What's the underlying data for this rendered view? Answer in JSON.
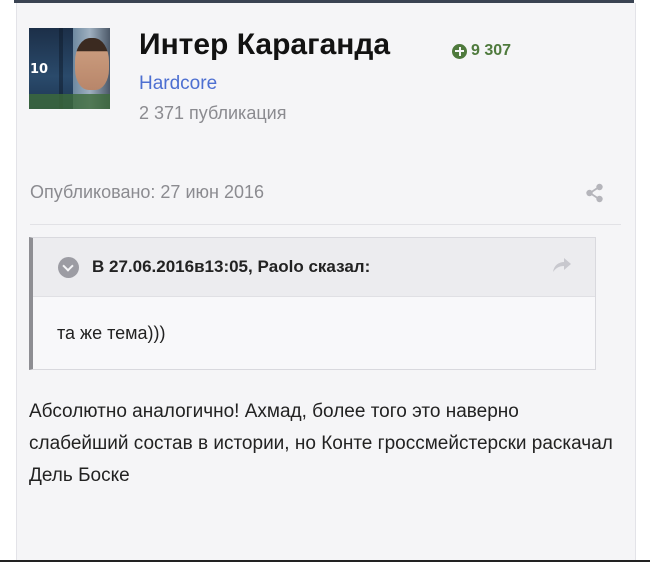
{
  "author": {
    "name": "Интер Караганда",
    "reputation": "9 307",
    "group": "Hardcore",
    "post_count": "2 371 публикация",
    "avatar_number": "10"
  },
  "post": {
    "published": "Опубликовано: 27 июн 2016",
    "quote": {
      "citation": "В 27.06.2016в13:05, Paolo сказал:",
      "text": "та же тема)))"
    },
    "content": "Абсолютно аналогично! Ахмад, более того это наверно слабейший состав в истории, но Конте гроссмейстерски раскачал Дель Боске"
  },
  "icons": [
    "plus-circle-icon",
    "share-icon",
    "chevron-down-icon",
    "reply-arrow-icon"
  ],
  "colors": {
    "reputation": "#4f7a3d",
    "group": "#4d6fd1",
    "muted": "#8b8b90",
    "card_bg": "#f5f5f7",
    "quote_border": "#8e8e93"
  }
}
